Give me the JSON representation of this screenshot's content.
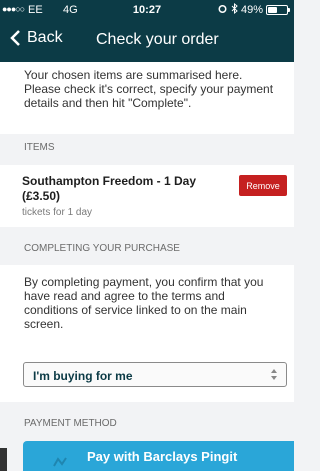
{
  "status_bar": {
    "signal": "●●●○○",
    "carrier": "EE",
    "network": "4G",
    "time": "10:27",
    "battery_percent": "49%",
    "battery_level": 0.49,
    "icons": [
      "alarm-icon",
      "bluetooth-icon",
      "battery-icon"
    ]
  },
  "nav": {
    "back_label": "Back",
    "title": "Check your order",
    "color": "#0c3b46"
  },
  "intro": {
    "text": "Your chosen items are summarised here. Please check it's correct, specify your payment details and then hit \"Complete\"."
  },
  "items_section": {
    "header": "ITEMS",
    "items": [
      {
        "title": "Southampton Freedom - 1 Day",
        "price": "(£3.50)",
        "subtitle": "tickets for 1 day",
        "remove_label": "Remove"
      }
    ]
  },
  "purchase_section": {
    "header": "COMPLETING YOUR PURCHASE",
    "terms": "By completing payment, you confirm that you have read and agree to the terms and conditions of service linked to on the main screen.",
    "select_value": "I'm buying for me"
  },
  "payment_section": {
    "header": "PAYMENT METHOD",
    "pingit_label": "Pay with Barclays Pingit",
    "pingit_color": "#2aa6d8"
  },
  "colors": {
    "remove": "#c52020",
    "background": "#f2f3f5"
  }
}
